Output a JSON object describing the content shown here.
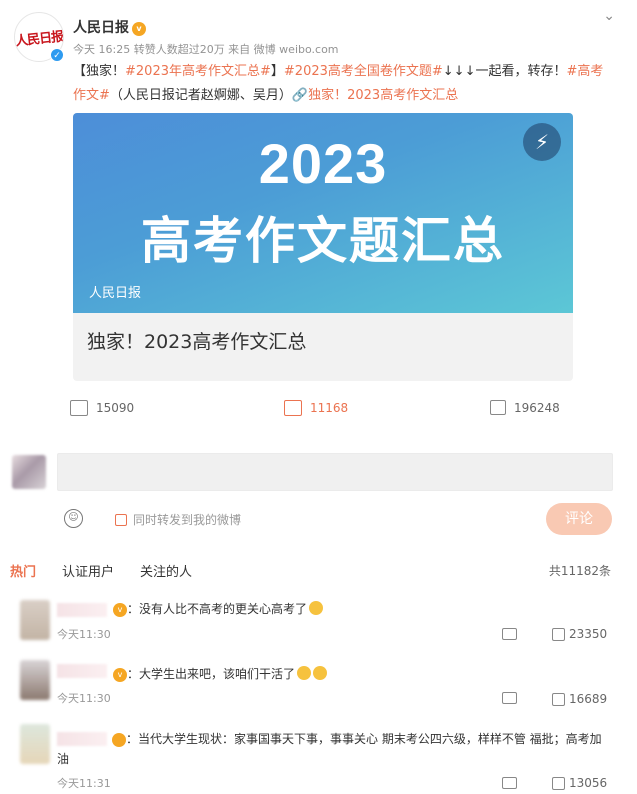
{
  "post": {
    "author": "人民日报",
    "logo_text": "人民日报",
    "meta": "今天 16:25 转赞人数超过20万  来自 微博 weibo.com",
    "text_prefix": "【独家！",
    "tag1": "#2023年高考作文汇总#",
    "text_mid1": "】",
    "tag2": "#2023高考全国卷作文题#",
    "text_mid2": "↓↓↓一起看，转存！",
    "tag3": "#高考作文#",
    "text_mid3": "（人民日报记者赵婀娜、吴月）",
    "link": "🔗独家！2023高考作文汇总"
  },
  "card": {
    "line1": "2023",
    "line2": "高考作文题汇总",
    "brand": "人民日报",
    "title": "独家！2023高考作文汇总"
  },
  "actions": {
    "repost": "15090",
    "comment": "11168",
    "like": "196248"
  },
  "composer": {
    "repost_checkbox_label": "同时转发到我的微博",
    "submit": "评论"
  },
  "tabs": [
    "热门",
    "认证用户",
    "关注的人"
  ],
  "total_comments": "共11182条",
  "comments": [
    {
      "text": "：没有人比不高考的更关心高考了",
      "time": "今天11:30",
      "likes": "23350"
    },
    {
      "text": "：大学生出来吧，该咱们干活了",
      "time": "今天11:30",
      "likes": "16689"
    },
    {
      "text": "：当代大学生现状：家事国事天下事，事事关心 期末考公四六级，样样不管 福批；高考加油",
      "time": "今天11:31",
      "likes": "13056"
    }
  ],
  "colors": {
    "accent": "#eb7350",
    "banner_start": "#4d8ed8",
    "banner_end": "#5cc7d6"
  }
}
